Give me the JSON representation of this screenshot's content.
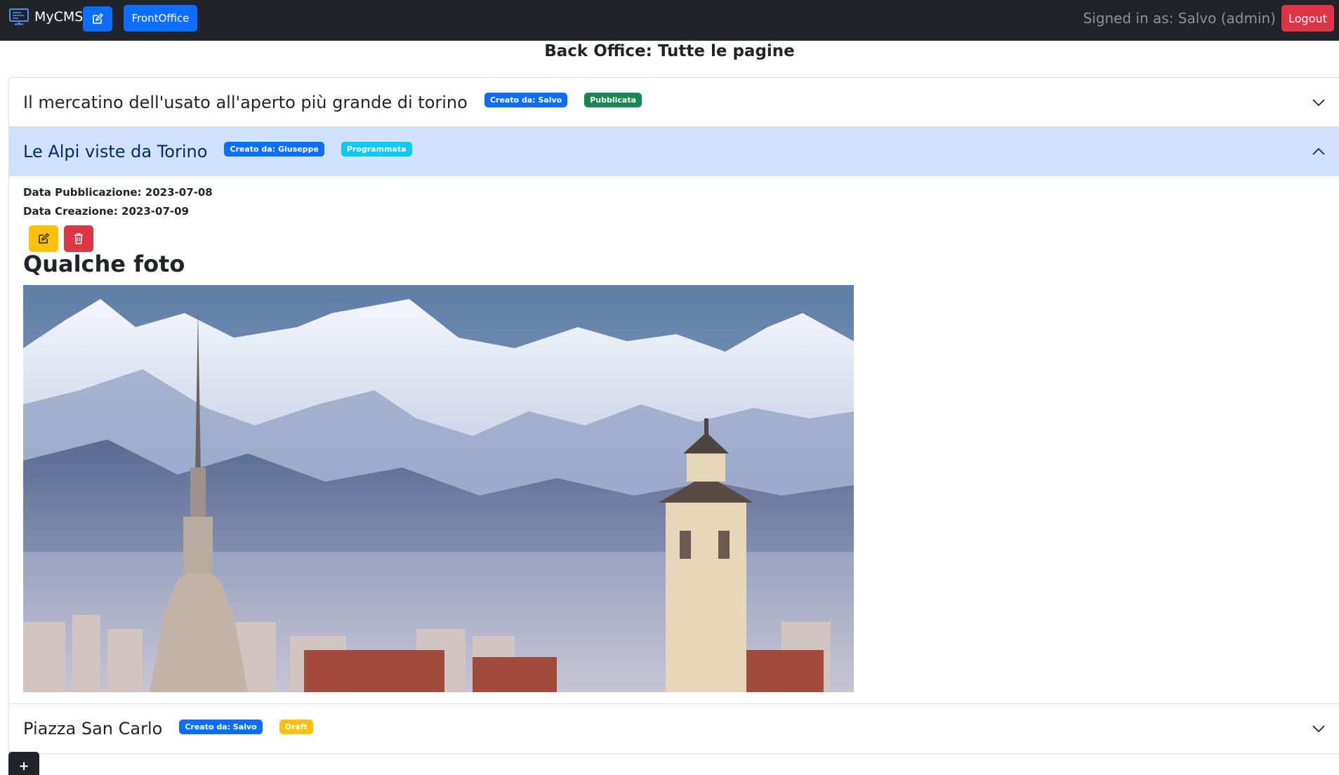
{
  "navbar": {
    "brand": "MyCMS",
    "brand_icon": "monitor-icon",
    "edit_icon": "pencil-square-icon",
    "frontoffice_label": "FrontOffice",
    "signed_in": "Signed in as: Salvo (admin)",
    "logout_label": "Logout"
  },
  "page": {
    "title": "Back Office: Tutte le pagine"
  },
  "pages": [
    {
      "title": "Il mercatino dell'usato all'aperto più grande di torino",
      "author_badge": "Creato da: Salvo",
      "status_badge": "Pubblicata",
      "status_color": "#198754",
      "expanded": false
    },
    {
      "title": "Le Alpi viste da Torino",
      "author_badge": "Creato da: Giuseppe",
      "status_badge": "Programmata",
      "status_color": "#0dcaf0",
      "expanded": true,
      "publication_date": "Data Pubblicazione: 2023-07-08",
      "creation_date": "Data Creazione: 2023-07-09",
      "heading": "Qualche foto"
    },
    {
      "title": "Piazza San Carlo",
      "author_badge": "Creato da: Salvo",
      "status_badge": "Draft",
      "status_color": "#ffc107",
      "expanded": false
    }
  ],
  "add_button_label": "+",
  "colors": {
    "navbar": "#212529",
    "primary": "#0d6efd",
    "danger": "#dc3545",
    "warning": "#ffc107",
    "active_header": "#cfe2ff"
  }
}
